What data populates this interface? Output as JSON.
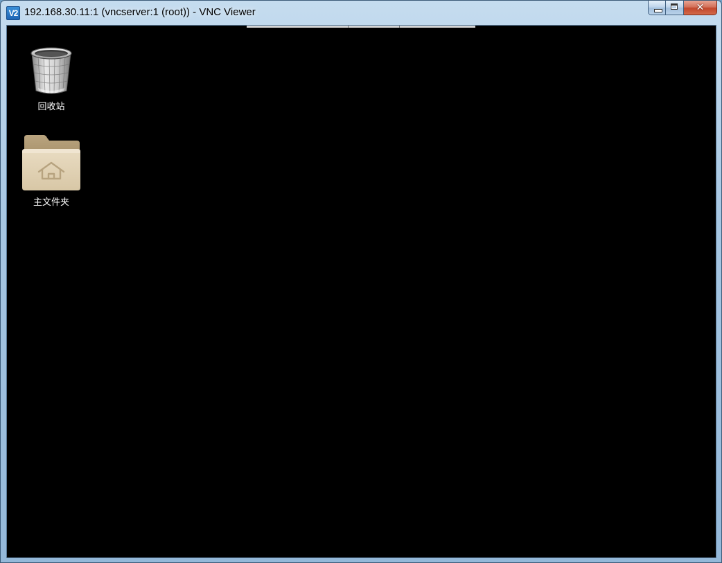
{
  "window": {
    "app_icon_text": "V2",
    "title": "192.168.30.11:1 (vncserver:1 (root)) - VNC Viewer",
    "buttons": {
      "minimize_icon": "minimize-icon",
      "maximize_icon": "maximize-icon",
      "close_icon": "close-icon",
      "close_glyph": "✕"
    }
  },
  "desktop": {
    "background_color": "#000000",
    "icons": [
      {
        "label": "回收站",
        "icon": "trash-icon"
      },
      {
        "label": "主文件夹",
        "icon": "home-folder-icon"
      }
    ]
  }
}
